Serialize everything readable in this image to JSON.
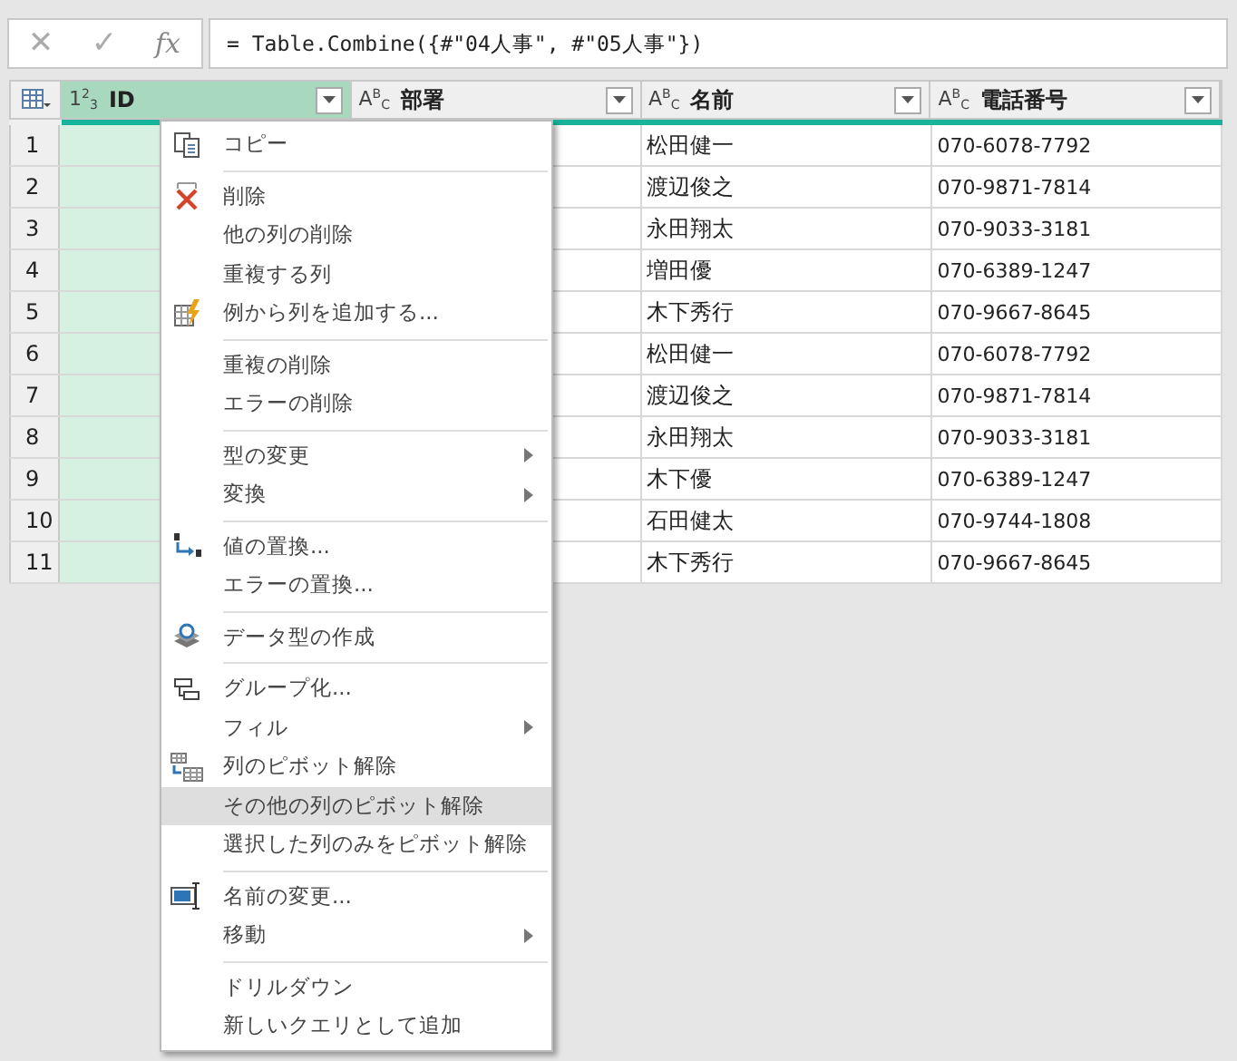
{
  "formula_bar": {
    "cancel": "✕",
    "confirm": "✓",
    "fx": "fx",
    "formula": "= Table.Combine({#\"04人事\", #\"05人事\"})"
  },
  "table": {
    "columns": [
      {
        "type_sup": "2",
        "type_a": "1",
        "type_b": "3",
        "label": "ID",
        "selected": true
      },
      {
        "type_sup": "B",
        "type_a": "A",
        "type_b": "C",
        "label": "部署",
        "selected": false
      },
      {
        "type_sup": "B",
        "type_a": "A",
        "type_b": "C",
        "label": "名前",
        "selected": false
      },
      {
        "type_sup": "B",
        "type_a": "A",
        "type_b": "C",
        "label": "電話番号",
        "selected": false
      }
    ],
    "rows": [
      {
        "num": "1",
        "name": "松田健一",
        "phone": "070-6078-7792"
      },
      {
        "num": "2",
        "name": "渡辺俊之",
        "phone": "070-9871-7814"
      },
      {
        "num": "3",
        "name": "永田翔太",
        "phone": "070-9033-3181"
      },
      {
        "num": "4",
        "name": "増田優",
        "phone": "070-6389-1247"
      },
      {
        "num": "5",
        "name": "木下秀行",
        "phone": "070-9667-8645"
      },
      {
        "num": "6",
        "name": "松田健一",
        "phone": "070-6078-7792"
      },
      {
        "num": "7",
        "name": "渡辺俊之",
        "phone": "070-9871-7814"
      },
      {
        "num": "8",
        "name": "永田翔太",
        "phone": "070-9033-3181"
      },
      {
        "num": "9",
        "name": "木下優",
        "phone": "070-6389-1247"
      },
      {
        "num": "10",
        "name": "石田健太",
        "phone": "070-9744-1808"
      },
      {
        "num": "11",
        "name": "木下秀行",
        "phone": "070-9667-8645"
      }
    ]
  },
  "context_menu": {
    "groups": [
      [
        {
          "label": "コピー",
          "kind": "copy",
          "submenu": false,
          "selected": false
        }
      ],
      [
        {
          "label": "削除",
          "kind": "delete",
          "submenu": false,
          "selected": false
        },
        {
          "label": "他の列の削除",
          "kind": "plain",
          "submenu": false,
          "selected": false
        },
        {
          "label": "重複する列",
          "kind": "plain",
          "submenu": false,
          "selected": false
        },
        {
          "label": "例から列を追加する...",
          "kind": "example",
          "submenu": false,
          "selected": false
        }
      ],
      [
        {
          "label": "重複の削除",
          "kind": "plain",
          "submenu": false,
          "selected": false
        },
        {
          "label": "エラーの削除",
          "kind": "plain",
          "submenu": false,
          "selected": false
        }
      ],
      [
        {
          "label": "型の変更",
          "kind": "plain",
          "submenu": true,
          "selected": false
        },
        {
          "label": "変換",
          "kind": "plain",
          "submenu": true,
          "selected": false
        }
      ],
      [
        {
          "label": "値の置換...",
          "kind": "replace",
          "submenu": false,
          "selected": false
        },
        {
          "label": "エラーの置換...",
          "kind": "plain",
          "submenu": false,
          "selected": false
        }
      ],
      [
        {
          "label": "データ型の作成",
          "kind": "datatype",
          "submenu": false,
          "selected": false
        }
      ],
      [
        {
          "label": "グループ化...",
          "kind": "group",
          "submenu": false,
          "selected": false
        },
        {
          "label": "フィル",
          "kind": "plain",
          "submenu": true,
          "selected": false
        },
        {
          "label": "列のピボット解除",
          "kind": "unpivot",
          "submenu": false,
          "selected": false
        },
        {
          "label": "その他の列のピボット解除",
          "kind": "plain",
          "submenu": false,
          "selected": true
        },
        {
          "label": "選択した列のみをピボット解除",
          "kind": "plain",
          "submenu": false,
          "selected": false
        }
      ],
      [
        {
          "label": "名前の変更...",
          "kind": "rename",
          "submenu": false,
          "selected": false
        },
        {
          "label": "移動",
          "kind": "plain",
          "submenu": true,
          "selected": false
        }
      ],
      [
        {
          "label": "ドリルダウン",
          "kind": "plain",
          "submenu": false,
          "selected": false
        },
        {
          "label": "新しいクエリとして追加",
          "kind": "plain",
          "submenu": false,
          "selected": false
        }
      ]
    ]
  }
}
